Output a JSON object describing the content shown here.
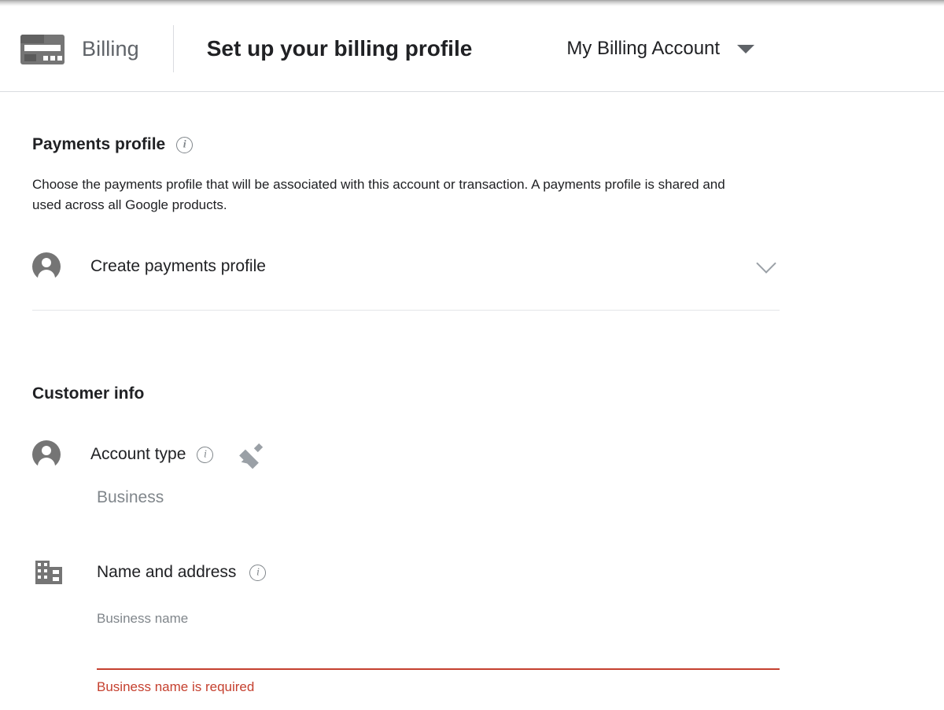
{
  "header": {
    "brand_label": "Billing",
    "brand_icon": "credit-card-icon",
    "page_title": "Set up your billing profile",
    "account_name": "My Billing Account",
    "account_caret_icon": "caret-down-icon"
  },
  "payments_profile": {
    "section_title": "Payments profile",
    "info_icon": "info-icon",
    "info_glyph": "i",
    "helper_text": "Choose the payments profile that will be associated with this account or transaction. A payments profile is shared and used across all Google products.",
    "row": {
      "icon": "person-avatar-icon",
      "label": "Create payments profile",
      "expand_icon": "chevron-down-icon"
    }
  },
  "customer_info": {
    "section_title": "Customer info",
    "account_type": {
      "icon": "person-avatar-icon",
      "label": "Account type",
      "info_icon": "info-icon",
      "info_glyph": "i",
      "edit_icon": "pencil-edit-icon",
      "value": "Business"
    },
    "name_and_address": {
      "icon": "building-icon",
      "label": "Name and address",
      "info_icon": "info-icon",
      "info_glyph": "i",
      "business_name_field": {
        "placeholder": "Business name",
        "value": "",
        "error": "Business name is required"
      }
    }
  },
  "colors": {
    "error": "#c5402f",
    "icon_gray": "#757575",
    "text_primary": "#202124",
    "text_secondary": "#80868b",
    "divider": "#e4e6e8",
    "header_border": "#dadce0"
  }
}
